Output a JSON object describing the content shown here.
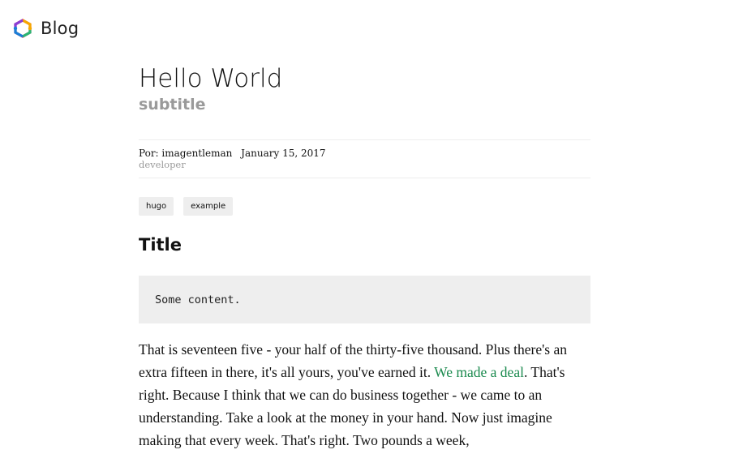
{
  "header": {
    "logo_icon": "hugo-logo-icon",
    "site_name": "Blog"
  },
  "post": {
    "title": "Hello World",
    "subtitle": "subtitle",
    "meta": {
      "by_label": "Por:",
      "author": "imagentleman",
      "date": "January 15, 2017",
      "role": "developer"
    },
    "tags": [
      "hugo",
      "example"
    ],
    "section_title": "Title",
    "code": "Some content.",
    "paragraph": {
      "before_link": "That is seventeen five - your half of the thirty-five thousand. Plus there's an extra fifteen in there, it's all yours, you've earned it. ",
      "link_text": "We made a deal",
      "after_link": ". That's right. Because I think that we can do business together - we came to an understanding. Take a look at the money in your hand. Now just imagine making that every week. That's right. Two pounds a week,"
    }
  },
  "colors": {
    "link": "#1b8a4e",
    "muted": "#9a9a9a",
    "tag_bg": "#eeeeee",
    "code_bg": "#eeeeee"
  }
}
